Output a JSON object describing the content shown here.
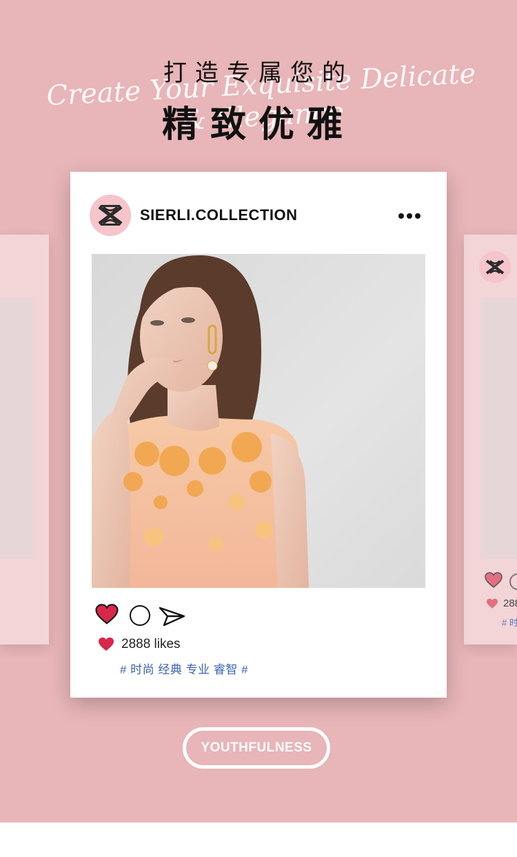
{
  "headline": {
    "line1": "打造专属您的",
    "line2": "精致优雅",
    "script_text": "Create Your Exquisite Delicate & Elegance"
  },
  "post": {
    "username": "SIERLI.COLLECTION",
    "likes_text": "2888 likes",
    "hashtags": "# 时尚 经典 专业 睿智 #",
    "avatar_icon": "sierli-logo-icon",
    "more_icon": "more-dots-icon",
    "like_icon": "heart-icon",
    "comment_icon": "comment-icon",
    "share_icon": "share-icon"
  },
  "side_card_right": {
    "likes_text": "288",
    "hashtags": "# 时"
  },
  "button": {
    "label": "YOUTHFULNESS"
  },
  "colors": {
    "background": "#e8b5b8",
    "card": "#ffffff",
    "side_card": "#f3d4d7",
    "avatar_bg": "#f6c4cb",
    "heart": "#d8274a",
    "hashtag": "#3a63b0"
  }
}
